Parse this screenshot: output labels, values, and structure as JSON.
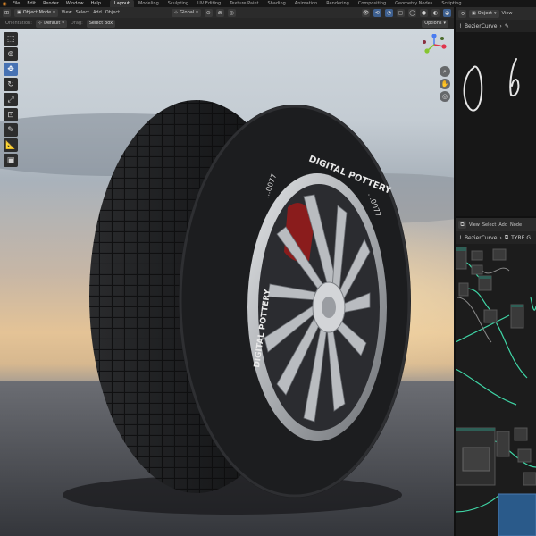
{
  "topbar": {
    "menus": [
      "File",
      "Edit",
      "Render",
      "Window",
      "Help"
    ],
    "workspaces": [
      "Layout",
      "Modeling",
      "Sculpting",
      "UV Editing",
      "Texture Paint",
      "Shading",
      "Animation",
      "Rendering",
      "Compositing",
      "Geometry Nodes",
      "Scripting"
    ],
    "active_workspace": "Layout"
  },
  "viewport_header": {
    "mode": "Object Mode",
    "menus": [
      "View",
      "Select",
      "Add",
      "Object"
    ],
    "transform_orientation": "Global"
  },
  "tool_header": {
    "orientation_label": "Orientation:",
    "orientation_value": "Default",
    "drag_label": "Drag:",
    "drag_value": "Select Box",
    "options": "Options"
  },
  "toolbar": {
    "tools": [
      "select-box-icon",
      "cursor-icon",
      "move-icon",
      "rotate-icon",
      "scale-icon",
      "transform-icon",
      "annotate-icon",
      "measure-icon",
      "add-cube-icon"
    ],
    "active_index": 2
  },
  "scene": {
    "tire_text_top": "DIGITAL POTTERY",
    "tire_text_code": "...0077",
    "tire_text_side": "DIGITAL POTTERY",
    "tire_text_side_code": "...0077"
  },
  "right_top": {
    "mode": "Object",
    "view": "View",
    "breadcrumb": "BezierCurve"
  },
  "node_editor": {
    "menus": [
      "View",
      "Select",
      "Add",
      "Node"
    ],
    "breadcrumb_object": "BezierCurve",
    "breadcrumb_tree": "TYRE G"
  },
  "colors": {
    "accent": "#4772b3",
    "node_link": "#3fd6a6"
  }
}
